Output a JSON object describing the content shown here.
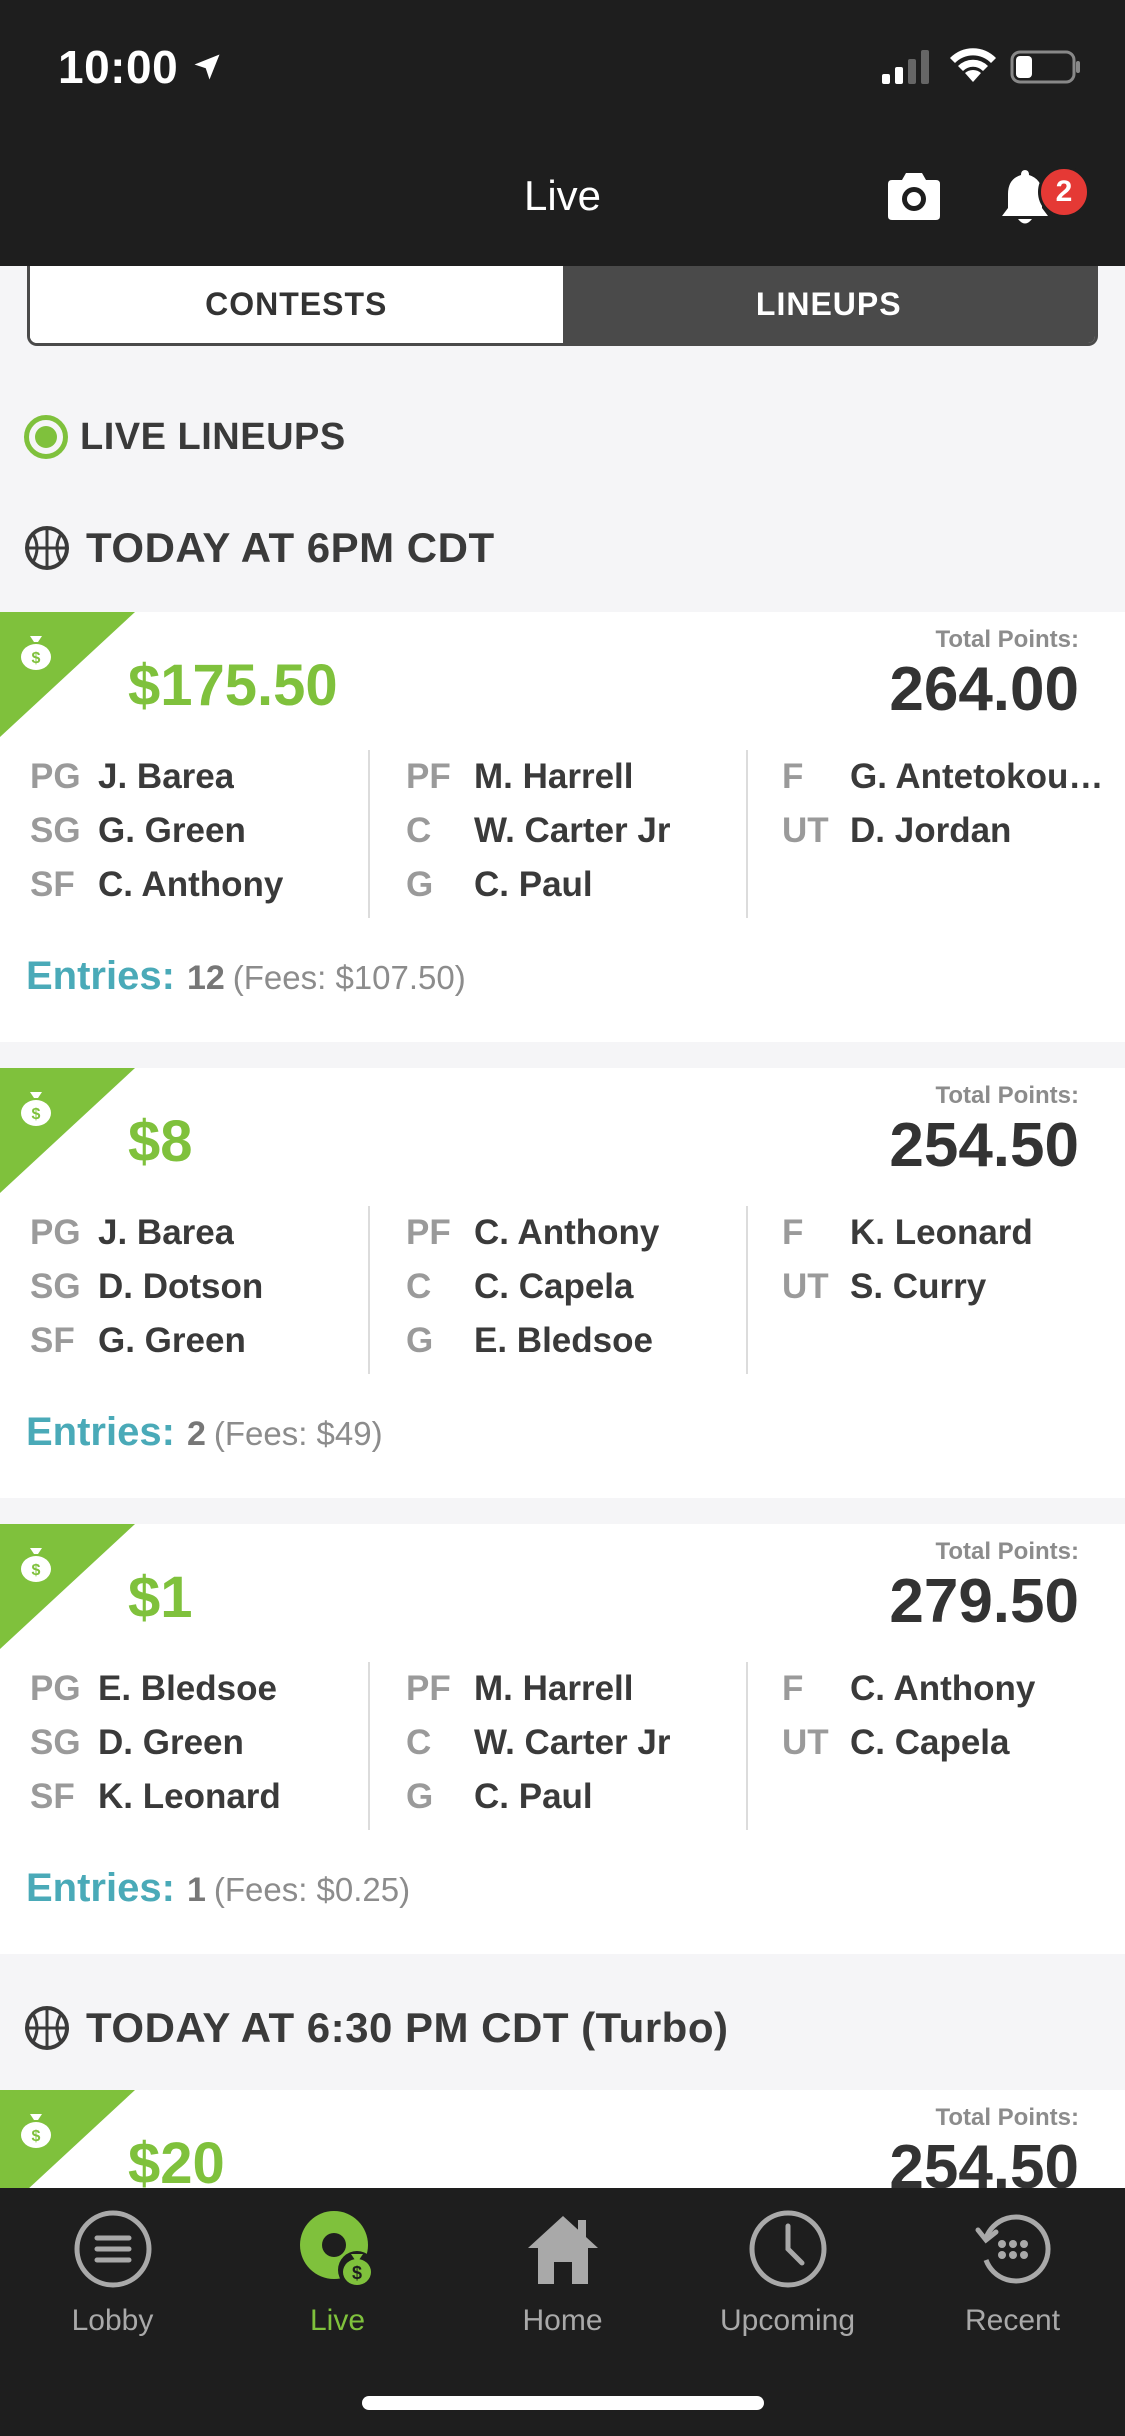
{
  "status_bar": {
    "time": "10:00"
  },
  "header": {
    "title": "Live",
    "notification_count": "2"
  },
  "segmented": {
    "contests_label": "CONTESTS",
    "lineups_label": "LINEUPS",
    "selected": "LINEUPS"
  },
  "live_lineups_heading": "LIVE LINEUPS",
  "groups": [
    {
      "heading": "TODAY AT 6PM CDT"
    },
    {
      "heading": "TODAY AT 6:30 PM CDT  (Turbo)"
    }
  ],
  "total_points_label": "Total Points:",
  "entries_label": "Entries:",
  "cards": [
    {
      "prize": "$175.50",
      "total_points": "264.00",
      "columns": [
        [
          {
            "pos": "PG",
            "player": "J. Barea"
          },
          {
            "pos": "SG",
            "player": "G. Green"
          },
          {
            "pos": "SF",
            "player": "C. Anthony"
          }
        ],
        [
          {
            "pos": "PF",
            "player": "M. Harrell"
          },
          {
            "pos": "C",
            "player": "W. Carter Jr"
          },
          {
            "pos": "G",
            "player": "C. Paul"
          }
        ],
        [
          {
            "pos": "F",
            "player": "G. Antetokou…"
          },
          {
            "pos": "UT",
            "player": "D. Jordan"
          }
        ]
      ],
      "entries": "12",
      "fees": "(Fees: $107.50)"
    },
    {
      "prize": "$8",
      "total_points": "254.50",
      "columns": [
        [
          {
            "pos": "PG",
            "player": "J. Barea"
          },
          {
            "pos": "SG",
            "player": "D. Dotson"
          },
          {
            "pos": "SF",
            "player": "G. Green"
          }
        ],
        [
          {
            "pos": "PF",
            "player": "C. Anthony"
          },
          {
            "pos": "C",
            "player": "C. Capela"
          },
          {
            "pos": "G",
            "player": "E. Bledsoe"
          }
        ],
        [
          {
            "pos": "F",
            "player": "K. Leonard"
          },
          {
            "pos": "UT",
            "player": "S. Curry"
          }
        ]
      ],
      "entries": "2",
      "fees": "(Fees: $49)"
    },
    {
      "prize": "$1",
      "total_points": "279.50",
      "columns": [
        [
          {
            "pos": "PG",
            "player": "E. Bledsoe"
          },
          {
            "pos": "SG",
            "player": "D. Green"
          },
          {
            "pos": "SF",
            "player": "K. Leonard"
          }
        ],
        [
          {
            "pos": "PF",
            "player": "M. Harrell"
          },
          {
            "pos": "C",
            "player": "W. Carter Jr"
          },
          {
            "pos": "G",
            "player": "C. Paul"
          }
        ],
        [
          {
            "pos": "F",
            "player": "C. Anthony"
          },
          {
            "pos": "UT",
            "player": "C. Capela"
          }
        ]
      ],
      "entries": "1",
      "fees": "(Fees: $0.25)"
    },
    {
      "prize": "$20",
      "total_points": "254.50"
    }
  ],
  "tabbar": {
    "items": [
      {
        "label": "Lobby",
        "icon": "menu-circle-icon"
      },
      {
        "label": "Live",
        "icon": "live-money-icon"
      },
      {
        "label": "Home",
        "icon": "home-icon"
      },
      {
        "label": "Upcoming",
        "icon": "clock-icon"
      },
      {
        "label": "Recent",
        "icon": "history-icon"
      }
    ],
    "active": "Live"
  },
  "colors": {
    "accent_green": "#7fc13c",
    "entries_teal": "#4aaab8",
    "dark_bar": "#1e1e1e",
    "badge_red": "#e53935"
  }
}
